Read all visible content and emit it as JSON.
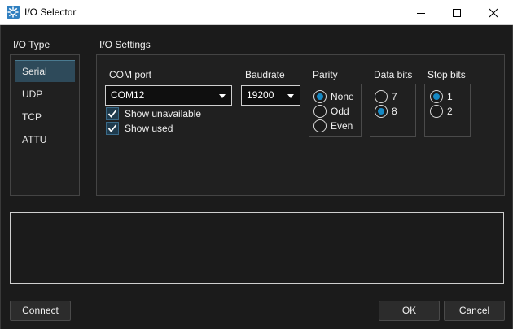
{
  "window": {
    "title": "I/O Selector"
  },
  "io_type": {
    "label": "I/O Type",
    "items": [
      "Serial",
      "UDP",
      "TCP",
      "ATTU"
    ],
    "selected": "Serial"
  },
  "io_settings": {
    "label": "I/O Settings",
    "com_port": {
      "label": "COM port",
      "value": "COM12"
    },
    "show_unavailable": {
      "label": "Show unavailable",
      "checked": true
    },
    "show_used": {
      "label": "Show used",
      "checked": true
    },
    "baudrate": {
      "label": "Baudrate",
      "value": "19200"
    },
    "parity": {
      "label": "Parity",
      "options": [
        "None",
        "Odd",
        "Even"
      ],
      "selected": "None"
    },
    "data_bits": {
      "label": "Data bits",
      "options": [
        "7",
        "8"
      ],
      "selected": "8"
    },
    "stop_bits": {
      "label": "Stop bits",
      "options": [
        "1",
        "2"
      ],
      "selected": "1"
    }
  },
  "buttons": {
    "connect": "Connect",
    "ok": "OK",
    "cancel": "Cancel"
  },
  "colors": {
    "accent": "#1689c4",
    "selection": "#2e4a5a",
    "background": "#1b1b1b"
  }
}
